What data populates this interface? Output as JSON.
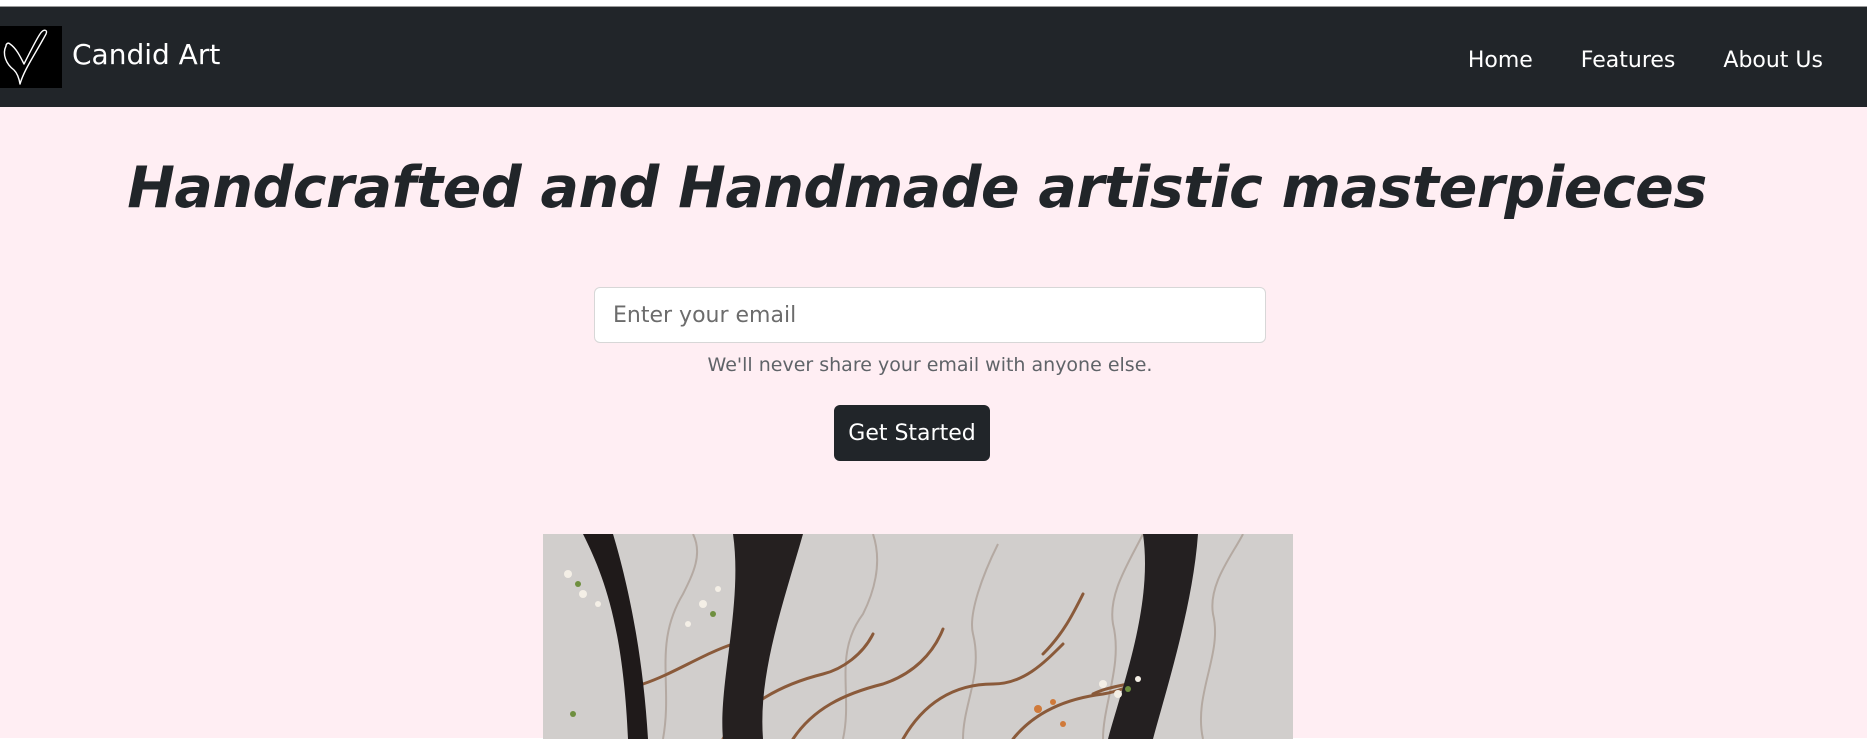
{
  "navbar": {
    "brand_name": "Candid Art",
    "logo_icon": "heart-signature-icon",
    "links": [
      {
        "label": "Home"
      },
      {
        "label": "Features"
      },
      {
        "label": "About Us"
      }
    ]
  },
  "hero": {
    "headline": "Handcrafted and Handmade artistic masterpieces",
    "email": {
      "placeholder": "Enter your email",
      "value": "",
      "help_text": "We'll never share your email with anyone else."
    },
    "cta_label": "Get Started"
  },
  "colors": {
    "navbar_bg": "#212529",
    "page_bg": "#ffeef3",
    "button_bg": "#212529",
    "text_dark": "#212529",
    "muted_text": "#5f6368"
  }
}
